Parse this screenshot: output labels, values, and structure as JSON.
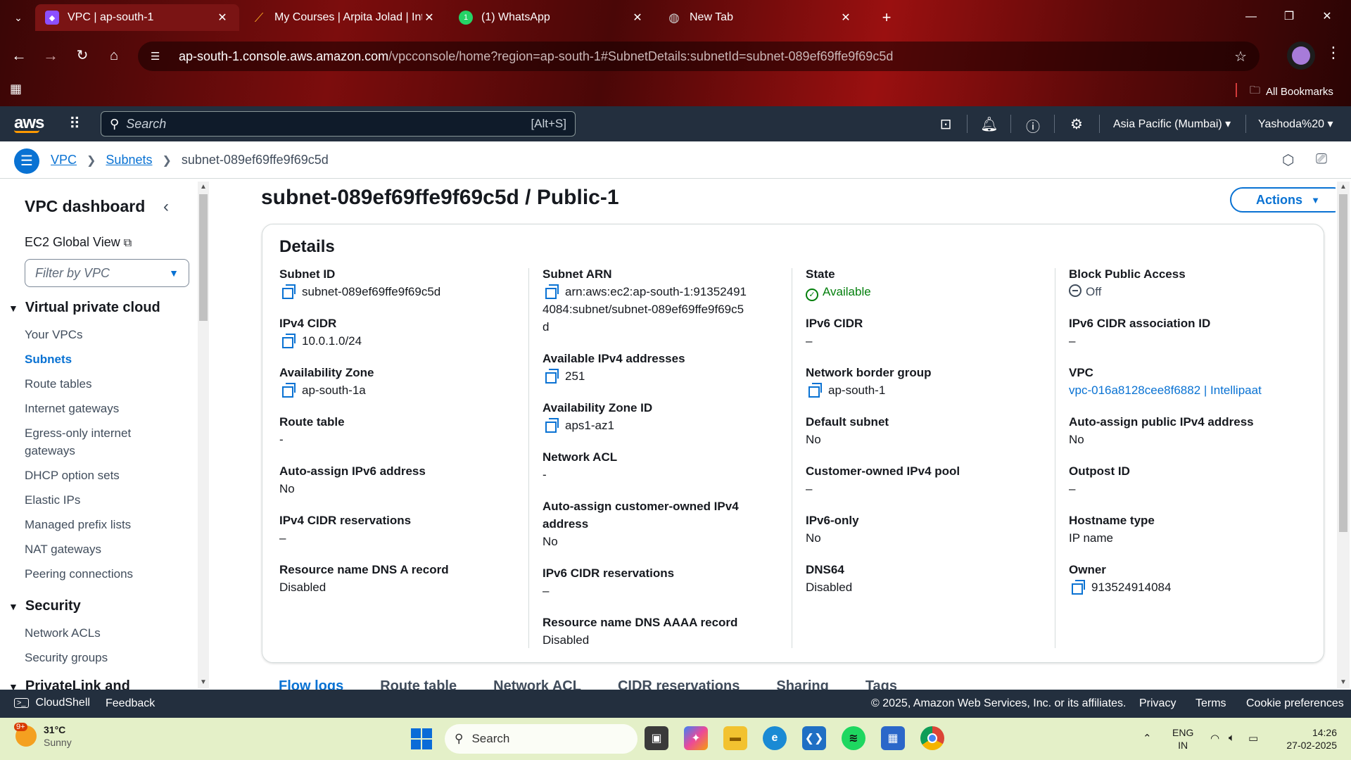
{
  "browser": {
    "tabs": [
      {
        "title": "VPC | ap-south-1",
        "icon": "vpc-favicon",
        "color": "#8c4fff"
      },
      {
        "title": "My Courses | Arpita Jolad | Intel",
        "icon": "intellipaat-favicon",
        "color": "#f6a623"
      },
      {
        "title": "(1) WhatsApp",
        "icon": "whatsapp-favicon",
        "color": "#25d366"
      },
      {
        "title": "New Tab",
        "icon": "globe-favicon",
        "color": "#cccccc"
      }
    ],
    "whatsapp_badge": "1",
    "url_host": "ap-south-1.console.aws.amazon.com",
    "url_path": "/vpcconsole/home?region=ap-south-1#SubnetDetails:subnetId=subnet-089ef69ffe9f69c5d",
    "all_bookmarks": "All Bookmarks"
  },
  "aws_nav": {
    "logo": "aws",
    "search_placeholder": "Search",
    "search_shortcut": "[Alt+S]",
    "region": "Asia Pacific (Mumbai)",
    "user": "Yashoda%20"
  },
  "breadcrumb": {
    "items": [
      "VPC",
      "Subnets"
    ],
    "current": "subnet-089ef69ffe9f69c5d"
  },
  "sidebar": {
    "title": "VPC dashboard",
    "ec2_global_view": "EC2 Global View",
    "filter_placeholder": "Filter by VPC",
    "sections": [
      {
        "title": "Virtual private cloud",
        "items": [
          "Your VPCs",
          "Subnets",
          "Route tables",
          "Internet gateways",
          "Egress-only internet gateways",
          "DHCP option sets",
          "Elastic IPs",
          "Managed prefix lists",
          "NAT gateways",
          "Peering connections"
        ]
      },
      {
        "title": "Security",
        "items": [
          "Network ACLs",
          "Security groups"
        ]
      },
      {
        "title": "PrivateLink and",
        "items": []
      }
    ],
    "active_item": "Subnets"
  },
  "main": {
    "title": "subnet-089ef69ffe9f69c5d / Public-1",
    "actions_label": "Actions",
    "details_heading": "Details",
    "columns": [
      [
        {
          "label": "Subnet ID",
          "value": "subnet-089ef69ffe9f69c5d",
          "copy": true
        },
        {
          "label": "IPv4 CIDR",
          "value": "10.0.1.0/24",
          "copy": true
        },
        {
          "label": "Availability Zone",
          "value": "ap-south-1a",
          "copy": true
        },
        {
          "label": "Route table",
          "value": "-"
        },
        {
          "label": "Auto-assign IPv6 address",
          "value": "No"
        },
        {
          "label": "IPv4 CIDR reservations",
          "value": "–"
        },
        {
          "label": "Resource name DNS A record",
          "value": "Disabled"
        }
      ],
      [
        {
          "label": "Subnet ARN",
          "value": "arn:aws:ec2:ap-south-1:913524914084:subnet/subnet-089ef69ffe9f69c5d",
          "copy": true
        },
        {
          "label": "Available IPv4 addresses",
          "value": "251",
          "copy": true
        },
        {
          "label": "Availability Zone ID",
          "value": "aps1-az1",
          "copy": true
        },
        {
          "label": "Network ACL",
          "value": "-"
        },
        {
          "label": "Auto-assign customer-owned IPv4 address",
          "value": "No"
        },
        {
          "label": "IPv6 CIDR reservations",
          "value": "–"
        },
        {
          "label": "Resource name DNS AAAA record",
          "value": "Disabled"
        }
      ],
      [
        {
          "label": "State",
          "value": "Available",
          "status": "ok"
        },
        {
          "label": "IPv6 CIDR",
          "value": "–"
        },
        {
          "label": "Network border group",
          "value": "ap-south-1",
          "copy": true
        },
        {
          "label": "Default subnet",
          "value": "No"
        },
        {
          "label": "Customer-owned IPv4 pool",
          "value": "–"
        },
        {
          "label": "IPv6-only",
          "value": "No"
        },
        {
          "label": "DNS64",
          "value": "Disabled"
        }
      ],
      [
        {
          "label": "Block Public Access",
          "value": "Off",
          "status": "off"
        },
        {
          "label": "IPv6 CIDR association ID",
          "value": "–"
        },
        {
          "label": "VPC",
          "value": "vpc-016a8128cee8f6882 | Intellipaat",
          "link": true
        },
        {
          "label": "Auto-assign public IPv4 address",
          "value": "No"
        },
        {
          "label": "Outpost ID",
          "value": "–"
        },
        {
          "label": "Hostname type",
          "value": "IP name"
        },
        {
          "label": "Owner",
          "value": "913524914084",
          "copy": true
        }
      ]
    ],
    "tabs": [
      "Flow logs",
      "Route table",
      "Network ACL",
      "CIDR reservations",
      "Sharing",
      "Tags"
    ]
  },
  "footer": {
    "cloudshell": "CloudShell",
    "feedback": "Feedback",
    "copyright": "© 2025, Amazon Web Services, Inc. or its affiliates.",
    "links": [
      "Privacy",
      "Terms",
      "Cookie preferences"
    ]
  },
  "taskbar": {
    "weather_temp": "31°C",
    "weather_desc": "Sunny",
    "weather_badge": "9+",
    "search_label": "Search",
    "lang_1": "ENG",
    "lang_2": "IN",
    "time": "14:26",
    "date": "27-02-2025"
  }
}
